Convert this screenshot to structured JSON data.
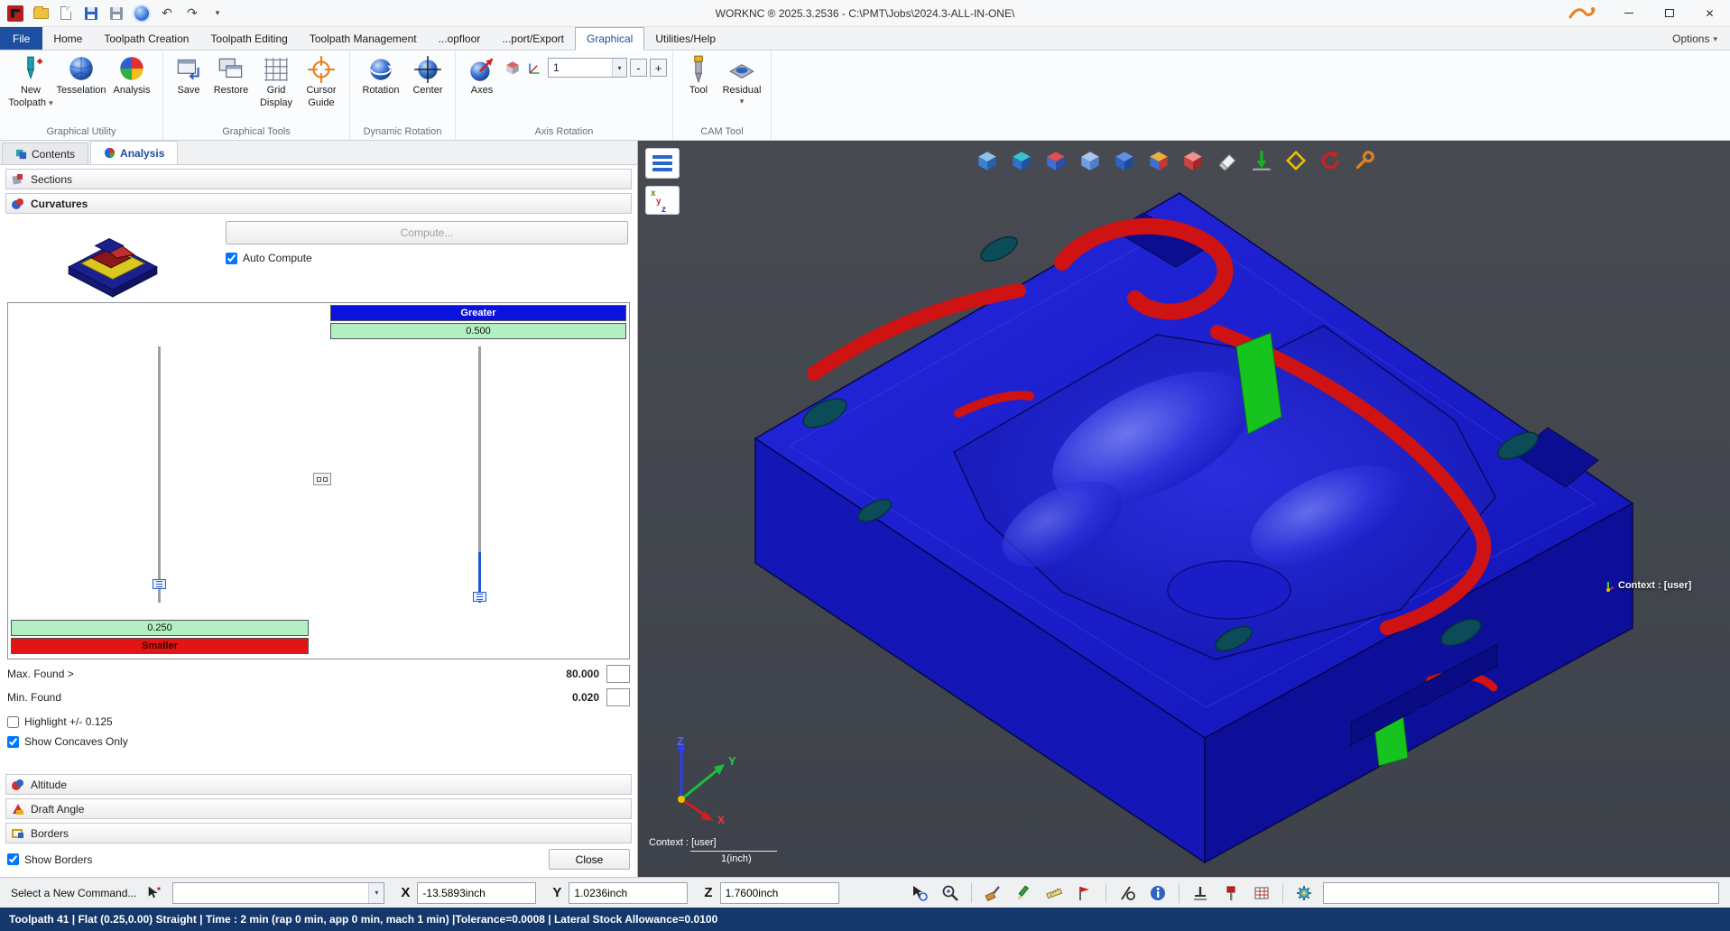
{
  "colors": {
    "accent_blue": "#1d4fa1",
    "status_bar_bg": "#14386b",
    "viewport_bg": "#43474e",
    "model_blue": "#1b1dd0",
    "scale_greater_bg": "#0a12dd",
    "scale_smaller_bg": "#e21414",
    "scale_green_bg": "#b2f0c2"
  },
  "titlebar": {
    "title": "WORKNC ® 2025.3.2536 - C:\\PMT\\Jobs\\2024.3-ALL-IN-ONE\\",
    "qat_icons": [
      "app-icon",
      "open-folder-icon",
      "new-file-icon",
      "save-icon",
      "save-all-icon",
      "graphics-mode-icon",
      "undo-icon",
      "redo-icon",
      "qat-overflow-icon"
    ],
    "window_icons": [
      "brand-logo-icon",
      "minimize-icon",
      "maximize-icon",
      "close-icon"
    ]
  },
  "glyphs": {
    "dropdown": "▾",
    "undo": "↶",
    "redo": "↷",
    "close": "✕"
  },
  "menubar": {
    "tabs": [
      {
        "label": "File"
      },
      {
        "label": "Home"
      },
      {
        "label": "Toolpath Creation"
      },
      {
        "label": "Toolpath Editing"
      },
      {
        "label": "Toolpath Management"
      },
      {
        "label": "...opfloor"
      },
      {
        "label": "...port/Export"
      },
      {
        "label": "Graphical"
      },
      {
        "label": "Utilities/Help"
      }
    ],
    "options_label": "Options"
  },
  "ribbon": {
    "group_labels": [
      "Graphical Utility",
      "Graphical Tools",
      "Dynamic Rotation",
      "Axis Rotation",
      "CAM Tool"
    ],
    "new_toolpath_l1": "New",
    "new_toolpath_l2": "Toolpath",
    "tesselation": "Tesselation",
    "analysis": "Analysis",
    "save": "Save",
    "restore": "Restore",
    "grid_l1": "Grid",
    "grid_l2": "Display",
    "cursor_l1": "Cursor",
    "cursor_l2": "Guide",
    "rotation": "Rotation",
    "center": "Center",
    "axes": "Axes",
    "axis_value": "1",
    "minus": "-",
    "plus": "+",
    "tool": "Tool",
    "residual": "Residual"
  },
  "left_panel": {
    "tabs": [
      {
        "label": "Contents"
      },
      {
        "label": "Analysis"
      }
    ],
    "sections_header": "Sections",
    "curvatures_header": "Curvatures",
    "compute_button": "Compute...",
    "auto_compute_label": "Auto Compute",
    "auto_compute_checked": true,
    "scale": {
      "greater_label": "Greater",
      "upper_value": "0.500",
      "lower_value": "0.250",
      "smaller_label": "Smaller"
    },
    "max_found_label": "Max. Found >",
    "max_found_value": "80.000",
    "min_found_label": "Min. Found",
    "min_found_value": "0.020",
    "highlight_label": "Highlight +/- 0.125",
    "highlight_checked": false,
    "show_concaves_label": "Show Concaves Only",
    "show_concaves_checked": true,
    "altitude_header": "Altitude",
    "draft_angle_header": "Draft Angle",
    "borders_header": "Borders",
    "show_borders_label": "Show Borders",
    "show_borders_checked": true,
    "close_button": "Close"
  },
  "viewport": {
    "context_label_model": "Context : [user]",
    "context_label_triad": "Context : [user]",
    "unit_label": "1(inch)",
    "axis_labels": {
      "x": "X",
      "y": "Y",
      "z": "Z"
    },
    "xyz_button": {
      "x": "x",
      "y": "y",
      "z": "z"
    },
    "toolbar_icons": [
      "shaded-view-icon",
      "mesh-view-icon",
      "dynamic-sections-icon",
      "transparent-view-icon",
      "solid-view-icon",
      "multi-color-view-icon",
      "stock-view-icon",
      "eraser-icon",
      "surface-normals-icon",
      "stock-limits-icon",
      "refresh-view-icon",
      "probe-tool-icon"
    ]
  },
  "command_bar": {
    "prompt": "Select a New Command...",
    "x_label": "X",
    "x_value": "-13.5893inch",
    "y_label": "Y",
    "y_value": "1.0236inch",
    "z_label": "Z",
    "z_value": "1.7600inch",
    "icons": [
      "select-zoom-icon",
      "zoom-window-icon",
      "paint-view-icon",
      "edit-geometry-icon",
      "measure-icon",
      "tag-icon",
      "hide-entity-icon",
      "entity-info-icon",
      "workplane-icon",
      "tool-setup-icon",
      "table-icon",
      "macro-settings-icon"
    ]
  },
  "status_bar": {
    "text": "Toolpath 41 | Flat (0.25,0.00) Straight | Time : 2 min (rap 0 min, app 0 min, mach 1 min) |Tolerance=0.0008 | Lateral Stock Allowance=0.0100"
  }
}
